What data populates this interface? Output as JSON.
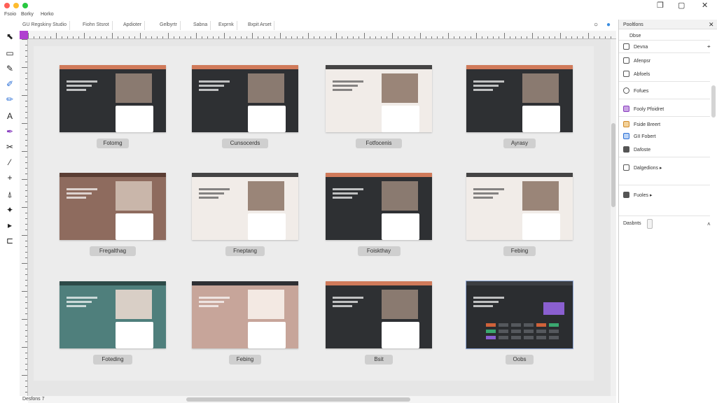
{
  "menu": [
    "Fsoio",
    "Borky",
    "Horko"
  ],
  "tabs": [
    "GU Regskiny Studio",
    "Fiohn Stsrot",
    "Apdioter",
    "Gelbyrtr",
    "Sabna",
    "Exprnk",
    "Bxpit Arset"
  ],
  "thumbnails": [
    {
      "label": "Fotomg",
      "style": "dark"
    },
    {
      "label": "Cunsocerds",
      "style": "dark"
    },
    {
      "label": "Fotfocenis",
      "style": "light"
    },
    {
      "label": "Ayrasy",
      "style": "dark"
    },
    {
      "label": "Fregalthag",
      "style": "brown"
    },
    {
      "label": "Fneptang",
      "style": "light"
    },
    {
      "label": "Foiskthay",
      "style": "dark"
    },
    {
      "label": "Febing",
      "style": "light"
    },
    {
      "label": "Foteding",
      "style": "teal"
    },
    {
      "label": "Febing",
      "style": "salmon"
    },
    {
      "label": "Bsit",
      "style": "dark"
    },
    {
      "label": "Oobs",
      "style": "chart"
    }
  ],
  "panel": {
    "title": "Pooltlons",
    "items": [
      "Dbse",
      "Devna",
      "Afenpsr",
      "Abfoels",
      "Fofues",
      "Fooly Pfoidret",
      "Fside Breert",
      "GII Fobert",
      "Dafoste",
      "Dalgedions",
      "Fuoles"
    ],
    "footer": "Dasbnts"
  },
  "status": "Desfons 7",
  "colors": {
    "accent": "#b040d0",
    "dark": "#2e3033",
    "stripe": "#d07a5a",
    "teal": "#4f7f7c"
  }
}
